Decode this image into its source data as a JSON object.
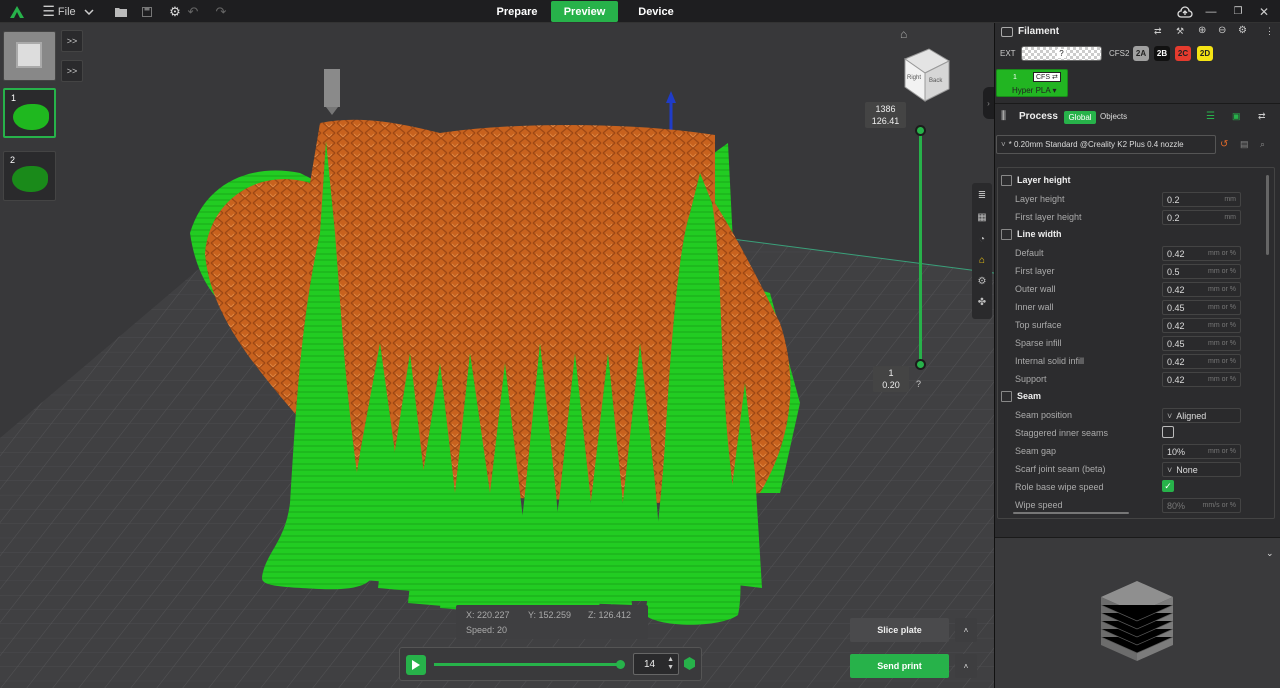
{
  "topbar": {
    "file_label": "File",
    "tabs": [
      {
        "label": "Prepare",
        "active": false
      },
      {
        "label": "Preview",
        "active": true
      },
      {
        "label": "Device",
        "active": false
      }
    ]
  },
  "plates": [
    {
      "label": ""
    },
    {
      "label": "1"
    },
    {
      "label": "2"
    }
  ],
  "sidebar_buttons": [
    ">>",
    ">>"
  ],
  "layer_slider": {
    "top_layer": "1386",
    "top_height": "126.41",
    "bottom_layer": "1",
    "bottom_height": "0.20",
    "help": "?"
  },
  "coords": {
    "x_label": "X:",
    "x": "220.227",
    "y_label": "Y:",
    "y": "152.259",
    "z_label": "Z:",
    "z": "126.412",
    "speed_label": "Speed:",
    "speed": "20"
  },
  "playback": {
    "move_value": "14",
    "progress": 0.98
  },
  "buttons": {
    "slice": "Slice plate",
    "send": "Send print"
  },
  "viewcube": {
    "face_right": "Right",
    "face_back": "Back"
  },
  "filament": {
    "title": "Filament",
    "ext_label": "EXT",
    "ext_value": "?",
    "cfs_label": "CFS2",
    "chips": [
      {
        "label": "2A",
        "color": "#a0a0a0",
        "text": "#222"
      },
      {
        "label": "2B",
        "color": "#111111",
        "text": "#fff"
      },
      {
        "label": "2C",
        "color": "#e53b2e",
        "text": "#222"
      },
      {
        "label": "2D",
        "color": "#f5e414",
        "text": "#222"
      }
    ],
    "slot_number": "1",
    "slot_tag": "CFS",
    "slot_name": "Hyper PLA"
  },
  "process": {
    "title": "Process",
    "global_label": "Global",
    "objects_label": "Objects",
    "preset": "* 0.20mm Standard @Creality K2 Plus 0.4 nozzle",
    "sections": {
      "layer_height": "Layer height",
      "line_width": "Line width",
      "seam": "Seam"
    },
    "layer_height_rows": [
      {
        "label": "Layer height",
        "value": "0.2",
        "unit": "mm"
      },
      {
        "label": "First layer height",
        "value": "0.2",
        "unit": "mm"
      }
    ],
    "line_width_rows": [
      {
        "label": "Default",
        "value": "0.42",
        "unit": "mm or %"
      },
      {
        "label": "First layer",
        "value": "0.5",
        "unit": "mm or %"
      },
      {
        "label": "Outer wall",
        "value": "0.42",
        "unit": "mm or %"
      },
      {
        "label": "Inner wall",
        "value": "0.45",
        "unit": "mm or %"
      },
      {
        "label": "Top surface",
        "value": "0.42",
        "unit": "mm or %"
      },
      {
        "label": "Sparse infill",
        "value": "0.45",
        "unit": "mm or %"
      },
      {
        "label": "Internal solid infill",
        "value": "0.42",
        "unit": "mm or %"
      },
      {
        "label": "Support",
        "value": "0.42",
        "unit": "mm or %"
      }
    ],
    "seam_rows": {
      "seam_position": {
        "label": "Seam position",
        "value": "Aligned"
      },
      "staggered": {
        "label": "Staggered inner seams",
        "checked": false
      },
      "seam_gap": {
        "label": "Seam gap",
        "value": "10%",
        "unit": "mm or %"
      },
      "scarf": {
        "label": "Scarf joint seam (beta)",
        "value": "None"
      },
      "role_wipe": {
        "label": "Role base wipe speed",
        "checked": true
      },
      "wipe_speed": {
        "label": "Wipe speed",
        "value": "80%",
        "unit": "mm/s or %"
      }
    }
  },
  "colors": {
    "accent": "#27b24a",
    "model_orange": "#c8621e",
    "support_green": "#22cc22"
  }
}
